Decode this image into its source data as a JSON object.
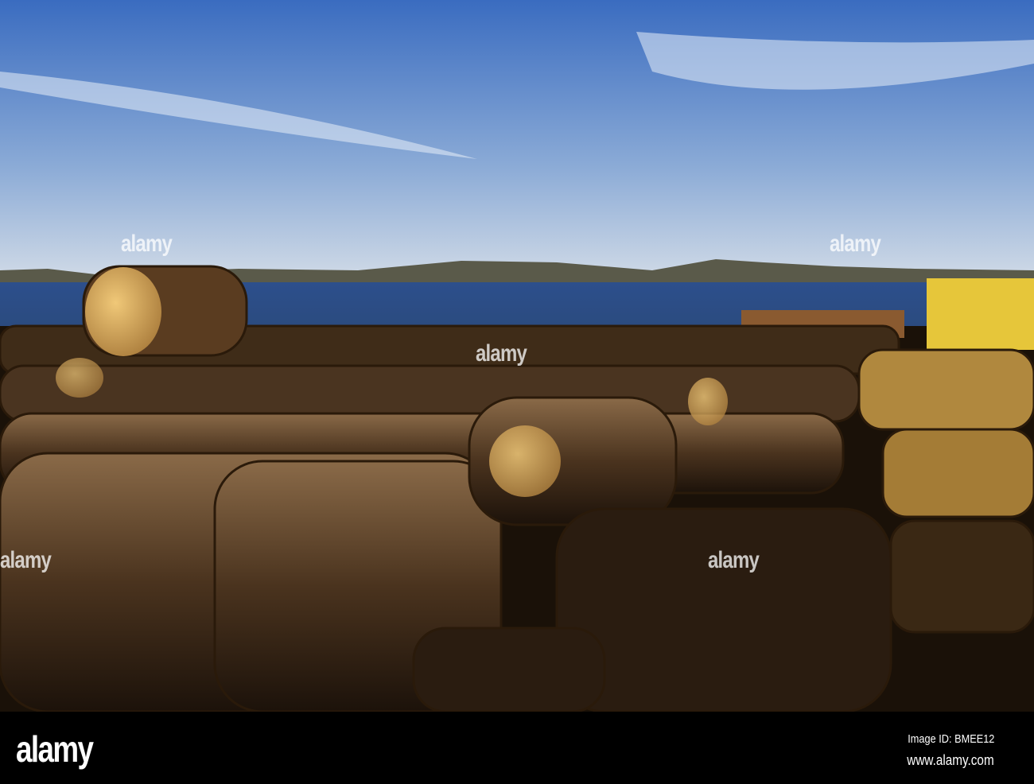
{
  "photo": {
    "description_label": "Wooden barrels on a quay by the sea"
  },
  "watermark": {
    "text": "alamy"
  },
  "footer": {
    "logo": "alamy",
    "image_id": "Image ID: BMEE12",
    "website": "www.alamy.com"
  },
  "colors": {
    "sky_top": "#3d6fbf",
    "sky_bottom": "#c9d6e6",
    "sea": "#2a4d8a",
    "barrel": "#5a3c20",
    "crate": "#e6c63a"
  }
}
